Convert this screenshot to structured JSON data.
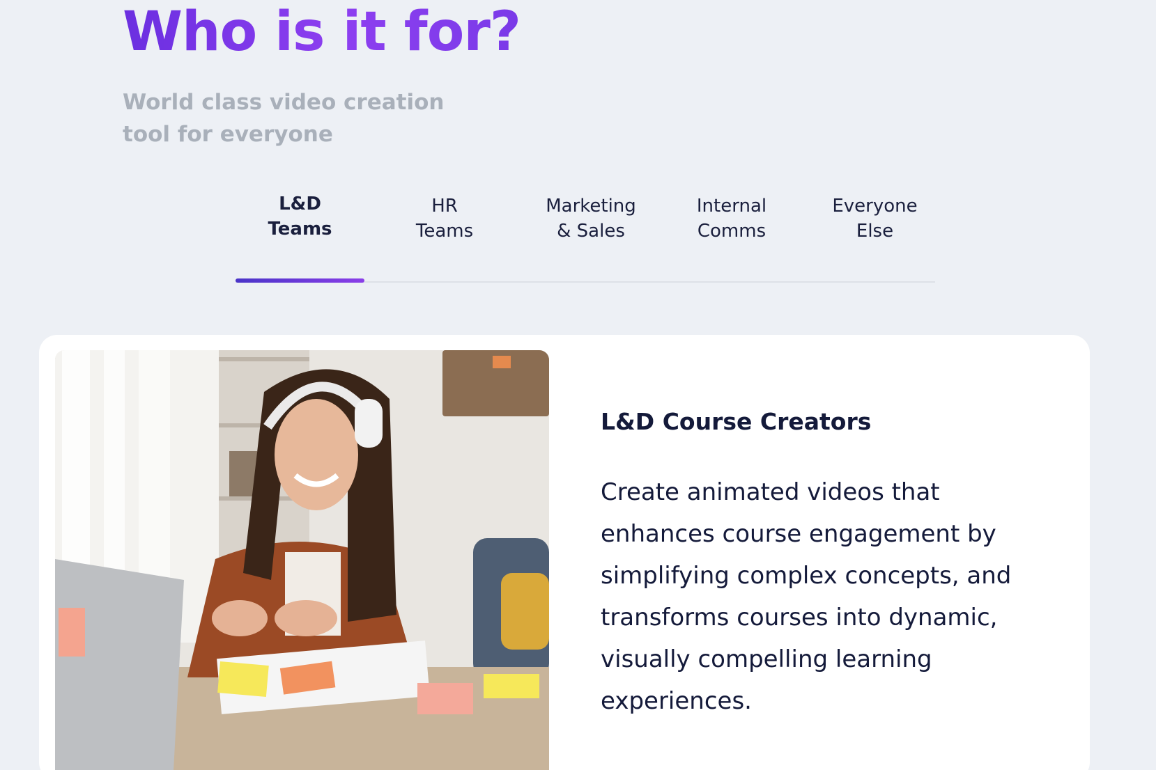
{
  "section": {
    "title": "Who is it for?",
    "subtitle_line1": "World class video creation",
    "subtitle_line2": "tool for everyone"
  },
  "tabs": [
    {
      "line1": "L&D",
      "line2": "Teams",
      "active": true
    },
    {
      "line1": "HR",
      "line2": "Teams",
      "active": false
    },
    {
      "line1": "Marketing",
      "line2": "& Sales",
      "active": false
    },
    {
      "line1": "Internal",
      "line2": "Comms",
      "active": false
    },
    {
      "line1": "Everyone",
      "line2": "Else",
      "active": false
    }
  ],
  "panel": {
    "heading": "L&D Course Creators",
    "body": "Create animated videos that enhances course engagement by simplifying complex concepts, and transforms courses into dynamic, visually compelling learning experiences."
  },
  "colors": {
    "accent_start": "#4a34c8",
    "accent_end": "#8a3ee8",
    "text_dark": "#141a3a",
    "muted": "#a9b0ba",
    "background": "#edf0f5"
  }
}
